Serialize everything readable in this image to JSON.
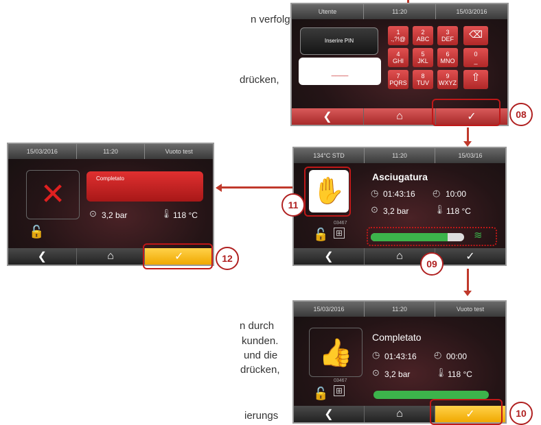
{
  "doc": {
    "line1": "n verfolgt",
    "line2": "drücken,",
    "line3": "n   durch",
    "line4": "kunden.",
    "line5": "und  die",
    "line6": "drücken,",
    "line7": "ierungs"
  },
  "screen_pin": {
    "top": [
      "Utente",
      "11:20",
      "15/03/2016"
    ],
    "pin_label": "Inserire PIN",
    "pin_value": "____",
    "keys": [
      {
        "n": "1",
        "s": ".,?!@"
      },
      {
        "n": "2",
        "s": "ABC"
      },
      {
        "n": "3",
        "s": "DEF"
      },
      {
        "n": "4",
        "s": "GHI"
      },
      {
        "n": "5",
        "s": "JKL"
      },
      {
        "n": "6",
        "s": "MNO"
      },
      {
        "n": "0",
        "s": "_"
      },
      {
        "n": "7",
        "s": "PQRS"
      },
      {
        "n": "8",
        "s": "TUV"
      },
      {
        "n": "9",
        "s": "WXYZ"
      }
    ],
    "callout": "08"
  },
  "screen_drying": {
    "top": [
      "134°C STD",
      "11:20",
      "15/03/16"
    ],
    "title": "Asciugatura",
    "elapsed": "01:43:16",
    "remaining": "10:00",
    "pressure": "3,2 bar",
    "temperature": "118 °C",
    "cycle_no": "03467",
    "progress": 0.82,
    "callout_stop": "11",
    "callout_progress": "09"
  },
  "screen_fail": {
    "top": [
      "15/03/2016",
      "11:20",
      "Vuoto test"
    ],
    "status": "Completato",
    "pressure": "3,2 bar",
    "temperature": "118 °C",
    "callout": "12"
  },
  "screen_done": {
    "top": [
      "15/03/2016",
      "11:20",
      "Vuoto test"
    ],
    "title": "Completato",
    "elapsed": "01:43:16",
    "remaining": "00:00",
    "pressure": "3,2 bar",
    "temperature": "118 °C",
    "cycle_no": "03467",
    "progress": 1.0,
    "callout": "10"
  }
}
